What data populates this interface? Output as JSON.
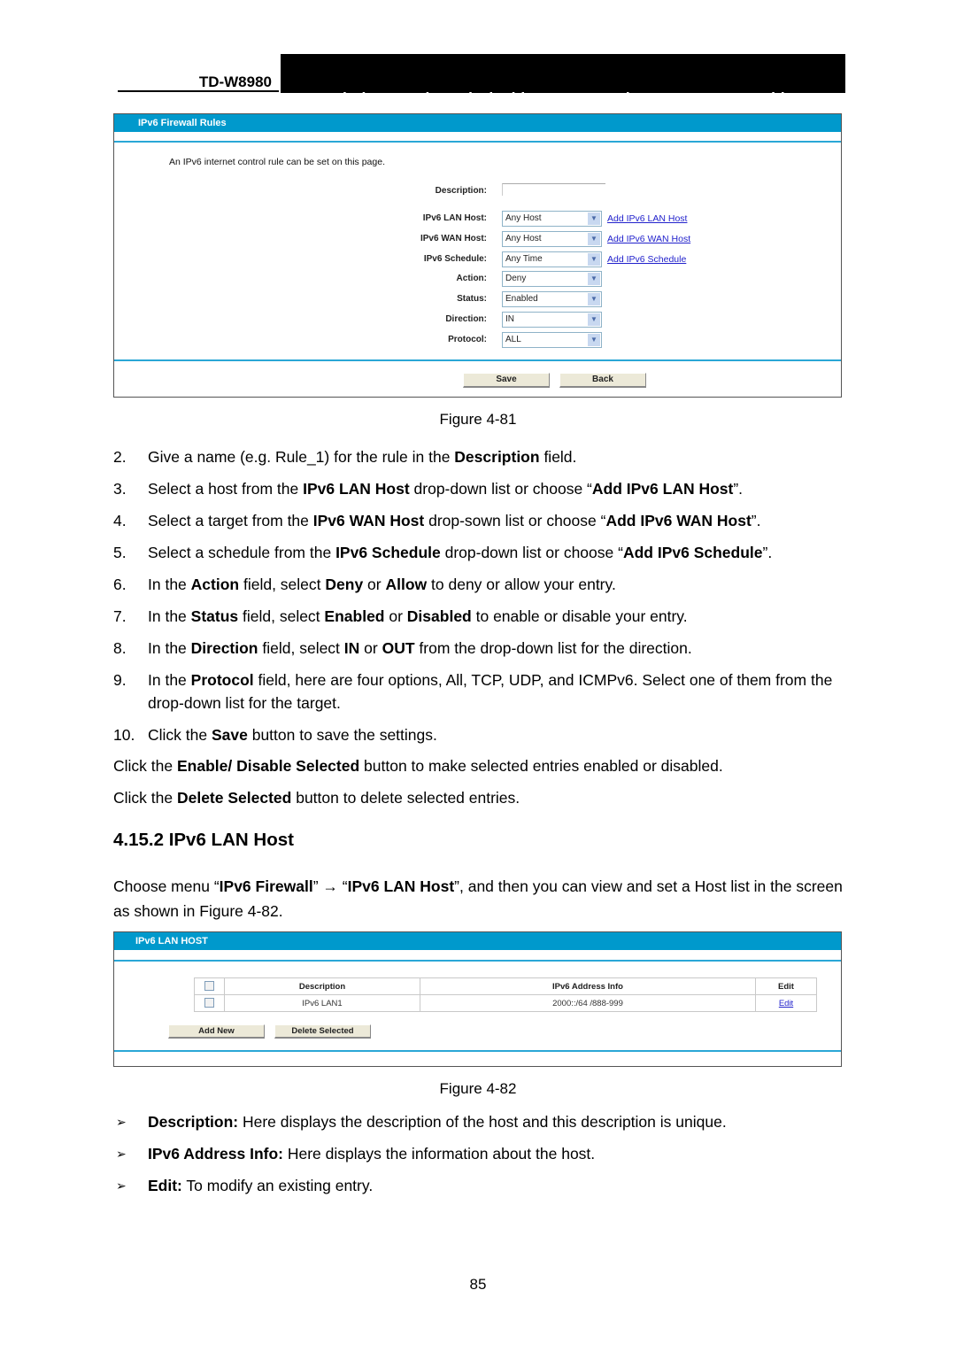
{
  "header": {
    "model": "TD-W8980",
    "title": "N600 Wireless Dual Band Gigabit ADSL2+ Modem Router User Guide"
  },
  "figure81": {
    "panel_title": "IPv6 Firewall Rules",
    "intro": "An IPv6 internet control rule can be set on this page.",
    "fields": {
      "description": {
        "label": "Description:",
        "value": ""
      },
      "lan_host": {
        "label": "IPv6 LAN Host:",
        "value": "Any Host",
        "link": "Add IPv6 LAN Host"
      },
      "wan_host": {
        "label": "IPv6 WAN Host:",
        "value": "Any Host",
        "link": "Add IPv6 WAN Host"
      },
      "schedule": {
        "label": "IPv6 Schedule:",
        "value": "Any Time",
        "link": "Add IPv6 Schedule"
      },
      "action": {
        "label": "Action:",
        "value": "Deny"
      },
      "status": {
        "label": "Status:",
        "value": "Enabled"
      },
      "direction": {
        "label": "Direction:",
        "value": "IN"
      },
      "protocol": {
        "label": "Protocol:",
        "value": "ALL"
      }
    },
    "buttons": {
      "save": "Save",
      "back": "Back"
    },
    "caption": "Figure 4-81"
  },
  "steps": [
    {
      "num": "2.",
      "parts": [
        [
          "Give a name (e.g. Rule_1) for the rule in the ",
          false
        ],
        [
          "Description",
          true
        ],
        [
          " field.",
          false
        ]
      ]
    },
    {
      "num": "3.",
      "parts": [
        [
          "Select a host from the ",
          false
        ],
        [
          "IPv6 LAN Host",
          true
        ],
        [
          " drop-down list or choose “",
          false
        ],
        [
          "Add IPv6 LAN Host",
          true
        ],
        [
          "”.",
          false
        ]
      ]
    },
    {
      "num": "4.",
      "parts": [
        [
          "Select a target from the ",
          false
        ],
        [
          "IPv6 WAN Host",
          true
        ],
        [
          " drop-sown list or choose “",
          false
        ],
        [
          "Add IPv6 WAN Host",
          true
        ],
        [
          "”.",
          false
        ]
      ]
    },
    {
      "num": "5.",
      "parts": [
        [
          "Select a schedule from the ",
          false
        ],
        [
          "IPv6 Schedule",
          true
        ],
        [
          " drop-down list or choose “",
          false
        ],
        [
          "Add IPv6 Schedule",
          true
        ],
        [
          "”.",
          false
        ]
      ]
    },
    {
      "num": "6.",
      "parts": [
        [
          "In the ",
          false
        ],
        [
          "Action",
          true
        ],
        [
          " field, select ",
          false
        ],
        [
          "Deny",
          true
        ],
        [
          " or ",
          false
        ],
        [
          "Allow",
          true
        ],
        [
          " to deny or allow your entry.",
          false
        ]
      ]
    },
    {
      "num": "7.",
      "parts": [
        [
          "In the ",
          false
        ],
        [
          "Status",
          true
        ],
        [
          " field, select ",
          false
        ],
        [
          "Enabled",
          true
        ],
        [
          " or ",
          false
        ],
        [
          "Disabled",
          true
        ],
        [
          " to enable or disable your entry.",
          false
        ]
      ]
    },
    {
      "num": "8.",
      "parts": [
        [
          "In the ",
          false
        ],
        [
          "Direction",
          true
        ],
        [
          " field, select ",
          false
        ],
        [
          "IN",
          true
        ],
        [
          " or ",
          false
        ],
        [
          "OUT",
          true
        ],
        [
          " from the drop-down list for the direction.",
          false
        ]
      ]
    },
    {
      "num": "9.",
      "parts": [
        [
          "In the ",
          false
        ],
        [
          "Protocol",
          true
        ],
        [
          " field, here are four options, All, TCP, UDP, and ICMPv6. Select one of them from the drop-down list for the target.",
          false
        ]
      ]
    },
    {
      "num": "10.",
      "parts": [
        [
          "Click the ",
          false
        ],
        [
          "Save",
          true
        ],
        [
          " button to save the settings.",
          false
        ]
      ]
    }
  ],
  "notes": [
    {
      "parts": [
        [
          "Click the ",
          false
        ],
        [
          "Enable/ Disable Selected",
          true
        ],
        [
          " button to make selected entries enabled or disabled.",
          false
        ]
      ]
    },
    {
      "parts": [
        [
          "Click the ",
          false
        ],
        [
          "Delete Selected",
          true
        ],
        [
          " button to delete selected entries.",
          false
        ]
      ]
    }
  ],
  "section": {
    "title": "4.15.2 IPv6 LAN Host",
    "intro_parts": [
      [
        "Choose menu “",
        false
      ],
      [
        "IPv6 Firewall",
        true
      ],
      [
        "”  →  “",
        false
      ],
      [
        "IPv6 LAN Host",
        true
      ],
      [
        "”, and then you can view and set a Host list in the screen as shown in Figure 4-82.",
        false
      ]
    ]
  },
  "figure82": {
    "panel_title": "IPv6 LAN HOST",
    "columns": [
      "",
      "Description",
      "IPv6 Address Info",
      "Edit"
    ],
    "rows": [
      {
        "description": "IPv6 LAN1",
        "address_info": "2000::/64 /888-999",
        "edit": "Edit"
      }
    ],
    "buttons": {
      "add_new": "Add New",
      "delete_selected": "Delete Selected"
    },
    "caption": "Figure 4-82"
  },
  "bullets": [
    {
      "parts": [
        [
          "Description:",
          true
        ],
        [
          " Here displays the description of the host and this description is unique.",
          false
        ]
      ]
    },
    {
      "parts": [
        [
          "IPv6 Address Info:",
          true
        ],
        [
          " Here displays the information about the host.",
          false
        ]
      ]
    },
    {
      "parts": [
        [
          "Edit:",
          true
        ],
        [
          " To modify an existing entry.",
          false
        ]
      ]
    }
  ],
  "bullet_marker": "➢",
  "page_number": "85"
}
